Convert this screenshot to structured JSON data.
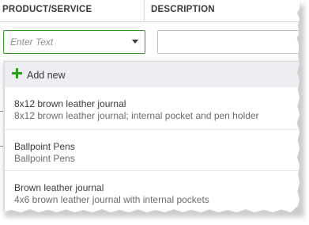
{
  "table": {
    "columns": [
      "PRODUCT/SERVICE",
      "DESCRIPTION"
    ]
  },
  "product_input": {
    "placeholder": "Enter Text",
    "value": ""
  },
  "dropdown": {
    "add_new_label": "Add new",
    "add_icon": "plus-icon",
    "items": [
      {
        "name": "8x12 brown leather journal",
        "detail": "8x12 brown leather journal; internal pocket and pen holder"
      },
      {
        "name": "Ballpoint Pens",
        "detail": "Ballpoint Pens"
      },
      {
        "name": "Brown leather journal",
        "detail": "4x6 brown leather journal with internal pockets"
      }
    ]
  },
  "colors": {
    "accent_green": "#2ca01c",
    "text": "#393a3d",
    "highlight_bg": "#eceef1"
  }
}
